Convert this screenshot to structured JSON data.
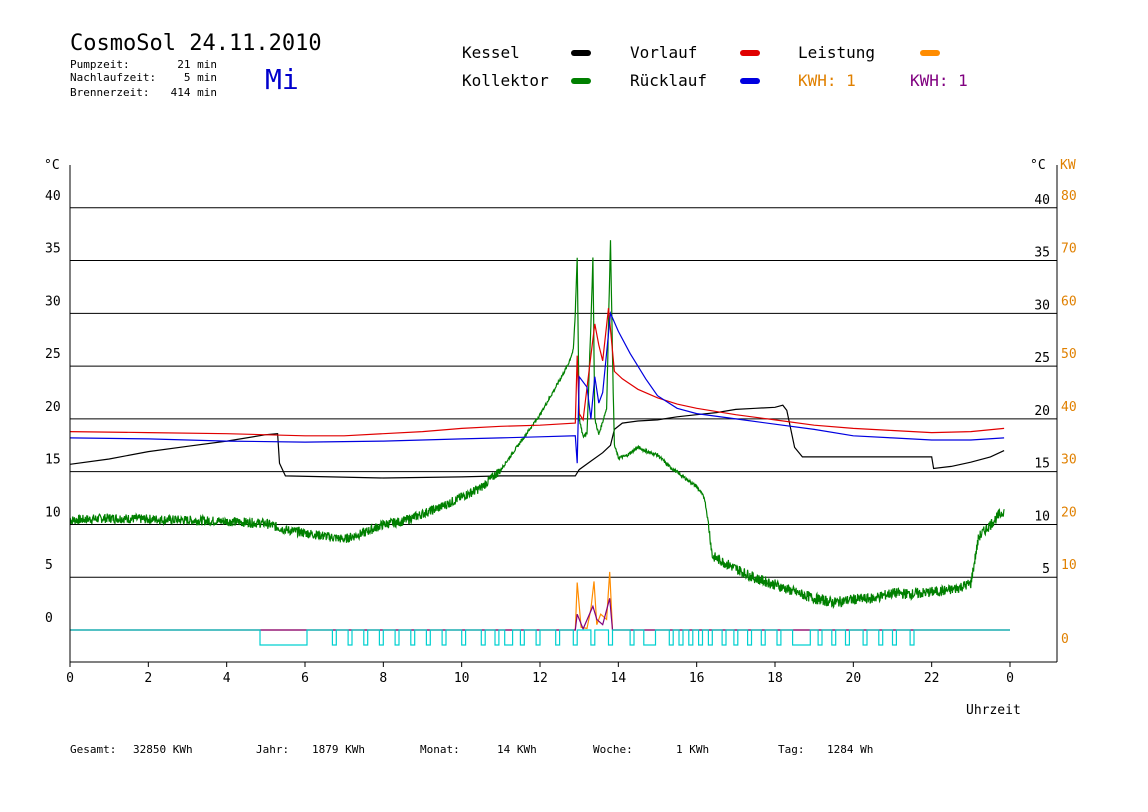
{
  "header": {
    "title": "CosmoSol 24.11.2010",
    "weekday": "Mi",
    "stats": [
      {
        "label": "Pumpzeit:",
        "value": "21 min"
      },
      {
        "label": "Nachlaufzeit:",
        "value": "5 min"
      },
      {
        "label": "Brennerzeit:",
        "value": "414 min"
      }
    ]
  },
  "legend": [
    {
      "label": "Kessel",
      "color": "#000000"
    },
    {
      "label": "Kollektor",
      "color": "#008000"
    },
    {
      "label": "Vorlauf",
      "color": "#e00000"
    },
    {
      "label": "Rücklauf",
      "color": "#0000e0"
    },
    {
      "label": "Leistung",
      "color": "#ff8c00"
    },
    {
      "label": "KWH: 1",
      "color": "#e08000"
    },
    {
      "label": "KWH: 1",
      "color": "#800080"
    }
  ],
  "footer": [
    {
      "label": "Gesamt:",
      "value": "32850 KWh"
    },
    {
      "label": "Jahr:",
      "value": "1879 KWh"
    },
    {
      "label": "Monat:",
      "value": "14 KWh"
    },
    {
      "label": "Woche:",
      "value": "1 KWh"
    },
    {
      "label": "Tag:",
      "value": "1284 Wh"
    }
  ],
  "chart_data": {
    "type": "line",
    "xlabel": "Uhrzeit",
    "ylabel_left": "°C",
    "ylabel_right": [
      "°C",
      "KW"
    ],
    "xlim": [
      0,
      24
    ],
    "ylim": [
      0,
      45
    ],
    "ylim_kw": [
      0,
      90
    ],
    "x_ticks": [
      "0",
      "2",
      "4",
      "6",
      "8",
      "10",
      "12",
      "14",
      "16",
      "18",
      "20",
      "22",
      "0"
    ],
    "y_ticks_left": [
      "0",
      "5",
      "10",
      "15",
      "20",
      "25",
      "30",
      "35",
      "40"
    ],
    "y_ticks_right": [
      "5",
      "10",
      "15",
      "20",
      "25",
      "30",
      "35",
      "40"
    ],
    "y_ticks_kw": [
      "0",
      "10",
      "20",
      "30",
      "40",
      "50",
      "60",
      "70",
      "80"
    ],
    "grid": true,
    "series": [
      {
        "name": "Kessel",
        "color": "#000000",
        "points": [
          [
            0,
            15.7
          ],
          [
            1,
            16.2
          ],
          [
            2,
            16.9
          ],
          [
            3,
            17.4
          ],
          [
            4,
            17.9
          ],
          [
            5,
            18.5
          ],
          [
            5.3,
            18.6
          ],
          [
            5.35,
            15.8
          ],
          [
            5.5,
            14.6
          ],
          [
            8,
            14.4
          ],
          [
            10,
            14.5
          ],
          [
            11,
            14.6
          ],
          [
            12,
            14.6
          ],
          [
            12.9,
            14.6
          ],
          [
            13.0,
            15.2
          ],
          [
            13.3,
            16
          ],
          [
            13.6,
            16.8
          ],
          [
            13.8,
            17.5
          ],
          [
            13.9,
            19
          ],
          [
            14.1,
            19.6
          ],
          [
            14.5,
            19.8
          ],
          [
            15,
            19.9
          ],
          [
            15.5,
            20.2
          ],
          [
            16,
            20.4
          ],
          [
            16.5,
            20.6
          ],
          [
            17,
            20.9
          ],
          [
            17.5,
            21
          ],
          [
            18,
            21.1
          ],
          [
            18.2,
            21.3
          ],
          [
            18.3,
            20.8
          ],
          [
            18.5,
            17.3
          ],
          [
            18.7,
            16.4
          ],
          [
            20,
            16.4
          ],
          [
            22,
            16.4
          ],
          [
            22.05,
            15.3
          ],
          [
            22.5,
            15.5
          ],
          [
            23,
            15.9
          ],
          [
            23.5,
            16.4
          ],
          [
            23.85,
            17
          ]
        ]
      },
      {
        "name": "Kollektor",
        "color": "#008000",
        "points": [
          [
            0,
            10.4
          ],
          [
            1,
            10.6
          ],
          [
            2,
            10.5
          ],
          [
            3,
            10.4
          ],
          [
            4,
            10.3
          ],
          [
            5,
            10.1
          ],
          [
            5.5,
            9.5
          ],
          [
            6,
            9.2
          ],
          [
            6.5,
            8.9
          ],
          [
            7,
            8.6
          ],
          [
            7.5,
            9.2
          ],
          [
            8,
            10
          ],
          [
            8.5,
            10.3
          ],
          [
            9,
            11
          ],
          [
            9.5,
            11.7
          ],
          [
            10,
            12.6
          ],
          [
            10.5,
            13.5
          ],
          [
            11,
            15.2
          ],
          [
            11.5,
            17.8
          ],
          [
            12,
            20.4
          ],
          [
            12.4,
            23
          ],
          [
            12.7,
            25
          ],
          [
            12.85,
            26.5
          ],
          [
            12.9,
            30
          ],
          [
            12.95,
            35.3
          ],
          [
            13.0,
            20
          ],
          [
            13.1,
            18.3
          ],
          [
            13.2,
            18.7
          ],
          [
            13.3,
            29
          ],
          [
            13.35,
            35.2
          ],
          [
            13.4,
            20
          ],
          [
            13.5,
            18.5
          ],
          [
            13.7,
            21
          ],
          [
            13.8,
            37
          ],
          [
            13.85,
            26
          ],
          [
            13.9,
            17.5
          ],
          [
            14.0,
            16.3
          ],
          [
            14.2,
            16.5
          ],
          [
            14.5,
            17.3
          ],
          [
            14.8,
            16.8
          ],
          [
            15,
            16.6
          ],
          [
            15.3,
            15.5
          ],
          [
            15.7,
            14.4
          ],
          [
            16,
            13.6
          ],
          [
            16.2,
            12.5
          ],
          [
            16.3,
            10.1
          ],
          [
            16.4,
            7
          ],
          [
            16.6,
            6.6
          ],
          [
            17,
            5.8
          ],
          [
            17.5,
            4.9
          ],
          [
            18,
            4.3
          ],
          [
            18.5,
            3.6
          ],
          [
            19,
            3.0
          ],
          [
            19.5,
            2.6
          ],
          [
            20,
            2.9
          ],
          [
            20.5,
            3.0
          ],
          [
            21,
            3.5
          ],
          [
            21.5,
            3.4
          ],
          [
            22,
            3.6
          ],
          [
            22.5,
            3.8
          ],
          [
            23,
            4.4
          ],
          [
            23.2,
            8.8
          ],
          [
            23.4,
            9.6
          ],
          [
            23.7,
            10.8
          ],
          [
            23.85,
            11.3
          ]
        ]
      },
      {
        "name": "Vorlauf",
        "color": "#e00000",
        "points": [
          [
            0,
            18.8
          ],
          [
            2,
            18.7
          ],
          [
            4,
            18.6
          ],
          [
            6,
            18.4
          ],
          [
            7,
            18.4
          ],
          [
            8,
            18.6
          ],
          [
            9,
            18.8
          ],
          [
            10,
            19.1
          ],
          [
            11,
            19.3
          ],
          [
            12,
            19.4
          ],
          [
            12.9,
            19.6
          ],
          [
            12.95,
            26
          ],
          [
            13.0,
            20.5
          ],
          [
            13.1,
            19.9
          ],
          [
            13.3,
            26
          ],
          [
            13.4,
            29
          ],
          [
            13.5,
            27
          ],
          [
            13.6,
            25.5
          ],
          [
            13.75,
            30.5
          ],
          [
            13.9,
            24.5
          ],
          [
            14.1,
            23.8
          ],
          [
            14.5,
            22.8
          ],
          [
            15,
            22.0
          ],
          [
            15.5,
            21.4
          ],
          [
            16,
            21
          ],
          [
            17,
            20.4
          ],
          [
            18,
            19.9
          ],
          [
            19,
            19.4
          ],
          [
            20,
            19.1
          ],
          [
            21,
            18.9
          ],
          [
            22,
            18.7
          ],
          [
            23,
            18.8
          ],
          [
            23.85,
            19.1
          ]
        ]
      },
      {
        "name": "Rücklauf",
        "color": "#0000e0",
        "points": [
          [
            0,
            18.2
          ],
          [
            2,
            18.1
          ],
          [
            4,
            17.9
          ],
          [
            6,
            17.8
          ],
          [
            8,
            17.9
          ],
          [
            10,
            18.1
          ],
          [
            11,
            18.2
          ],
          [
            12,
            18.3
          ],
          [
            12.9,
            18.4
          ],
          [
            12.95,
            15.8
          ],
          [
            13.0,
            24
          ],
          [
            13.2,
            23
          ],
          [
            13.3,
            20
          ],
          [
            13.4,
            24
          ],
          [
            13.5,
            21.5
          ],
          [
            13.6,
            22.5
          ],
          [
            13.8,
            30
          ],
          [
            14,
            28.3
          ],
          [
            14.3,
            26.2
          ],
          [
            14.7,
            23.8
          ],
          [
            15,
            22.2
          ],
          [
            15.5,
            21
          ],
          [
            16,
            20.5
          ],
          [
            17,
            20
          ],
          [
            18,
            19.5
          ],
          [
            19,
            19
          ],
          [
            20,
            18.4
          ],
          [
            21,
            18.2
          ],
          [
            22,
            18
          ],
          [
            23,
            18
          ],
          [
            23.85,
            18.2
          ]
        ]
      }
    ],
    "leistung": {
      "name": "Leistung",
      "color": "#ff8c00",
      "unit": "KW",
      "points": [
        [
          0,
          0
        ],
        [
          12.9,
          0
        ],
        [
          12.95,
          9
        ],
        [
          13.05,
          0.5
        ],
        [
          13.2,
          0.3
        ],
        [
          13.3,
          4
        ],
        [
          13.38,
          9.2
        ],
        [
          13.45,
          1
        ],
        [
          13.55,
          3
        ],
        [
          13.7,
          2
        ],
        [
          13.78,
          11
        ],
        [
          13.85,
          0
        ],
        [
          24,
          0
        ]
      ]
    },
    "kwh": {
      "color": "#800080",
      "unit": "KW",
      "points": [
        [
          0,
          0
        ],
        [
          12.9,
          0
        ],
        [
          12.95,
          3
        ],
        [
          13.1,
          0.2
        ],
        [
          13.35,
          4.5
        ],
        [
          13.45,
          2
        ],
        [
          13.6,
          1
        ],
        [
          13.78,
          6
        ],
        [
          13.85,
          0
        ],
        [
          24,
          0
        ]
      ]
    },
    "pump_signal": {
      "color": "#00d0d0",
      "intervals": [
        [
          4.85,
          6.05
        ],
        [
          6.7,
          6.8
        ],
        [
          7.1,
          7.2
        ],
        [
          7.5,
          7.6
        ],
        [
          7.9,
          8.0
        ],
        [
          8.3,
          8.4
        ],
        [
          8.7,
          8.8
        ],
        [
          9.1,
          9.2
        ],
        [
          9.5,
          9.6
        ],
        [
          10.0,
          10.1
        ],
        [
          10.5,
          10.6
        ],
        [
          10.85,
          10.95
        ],
        [
          11.1,
          11.3
        ],
        [
          11.5,
          11.6
        ],
        [
          11.9,
          12.0
        ],
        [
          12.4,
          12.5
        ],
        [
          12.85,
          12.95
        ],
        [
          13.3,
          13.4
        ],
        [
          13.75,
          13.85
        ],
        [
          14.3,
          14.4
        ],
        [
          14.65,
          14.95
        ],
        [
          15.3,
          15.4
        ],
        [
          15.55,
          15.65
        ],
        [
          15.8,
          15.9
        ],
        [
          16.05,
          16.15
        ],
        [
          16.3,
          16.4
        ],
        [
          16.65,
          16.75
        ],
        [
          16.95,
          17.05
        ],
        [
          17.3,
          17.4
        ],
        [
          17.65,
          17.75
        ],
        [
          18.05,
          18.15
        ],
        [
          18.45,
          18.9
        ],
        [
          19.1,
          19.2
        ],
        [
          19.45,
          19.55
        ],
        [
          19.8,
          19.9
        ],
        [
          20.25,
          20.35
        ],
        [
          20.65,
          20.75
        ],
        [
          21.0,
          21.1
        ],
        [
          21.45,
          21.55
        ]
      ]
    }
  }
}
